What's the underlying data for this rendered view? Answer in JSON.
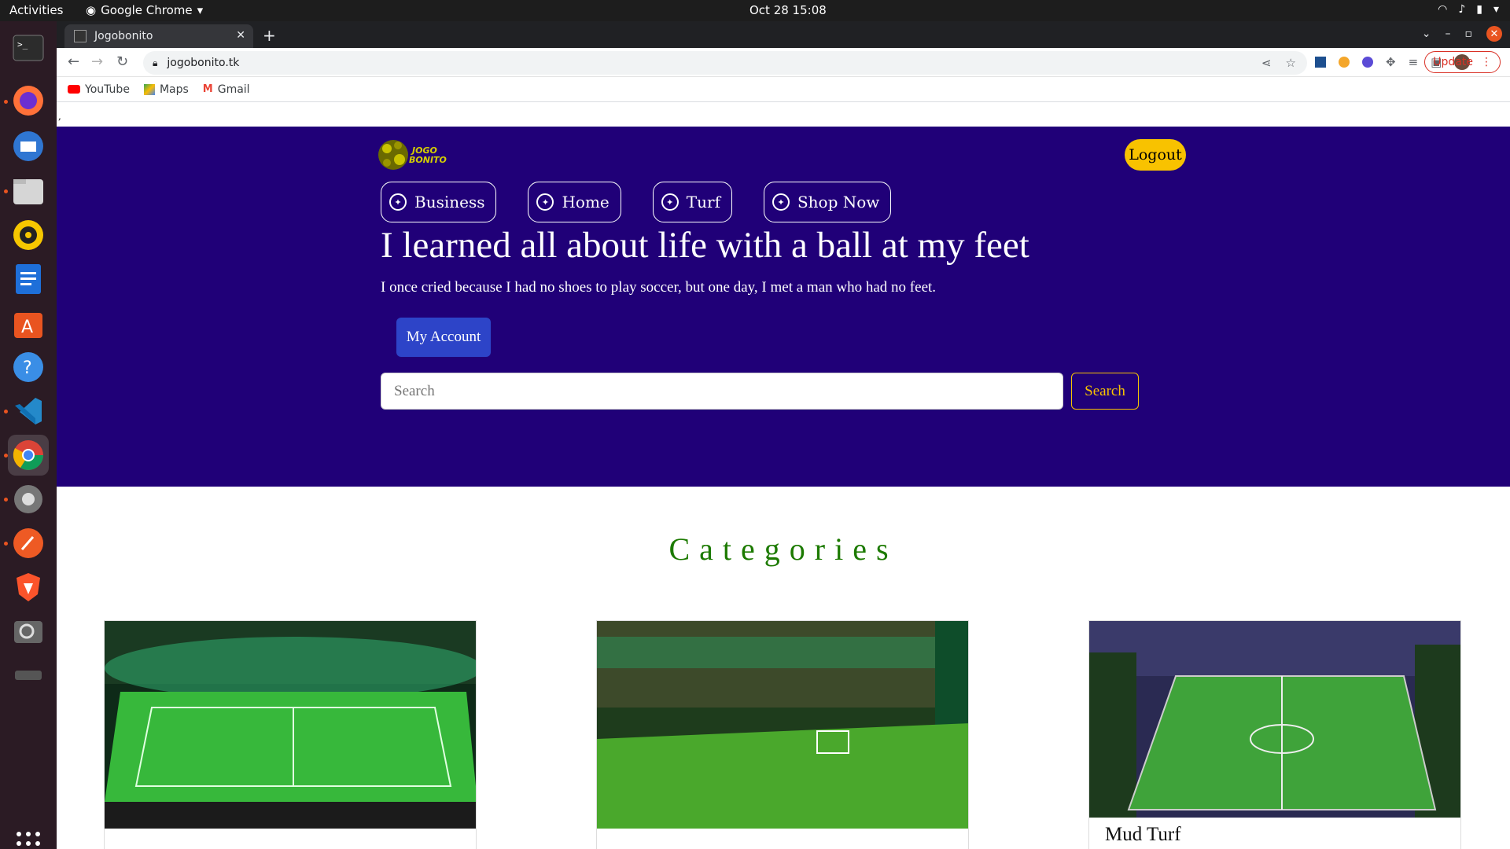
{
  "os": {
    "activities": "Activities",
    "app_name": "Google Chrome",
    "clock": "Oct 28  15:08"
  },
  "browser": {
    "tab_title": "Jogobonito",
    "url": "jogobonito.tk",
    "update_label": "Update",
    "bookmarks": [
      "YouTube",
      "Maps",
      "Gmail"
    ]
  },
  "page": {
    "stray_char": ",",
    "logo_text_top": "JOGO",
    "logo_text_bottom": "BONITO",
    "logout": "Logout",
    "nav": [
      "Business",
      "Home",
      "Turf",
      "Shop Now"
    ],
    "headline": "I learned all about life with a ball at my feet",
    "subline": "I once cried because I had no shoes to play soccer, but one day, I met a man who had no feet.",
    "my_account": "My Account",
    "search_placeholder": "Search",
    "search_button": "Search",
    "categories_title": "Categories",
    "cards": [
      {
        "title": ""
      },
      {
        "title": ""
      },
      {
        "title": "Mud Turf"
      }
    ]
  },
  "colors": {
    "hero_bg": "#200078",
    "accent_yellow": "#f8c200",
    "account_blue": "#2d44c8",
    "category_green": "#1c7a00"
  }
}
